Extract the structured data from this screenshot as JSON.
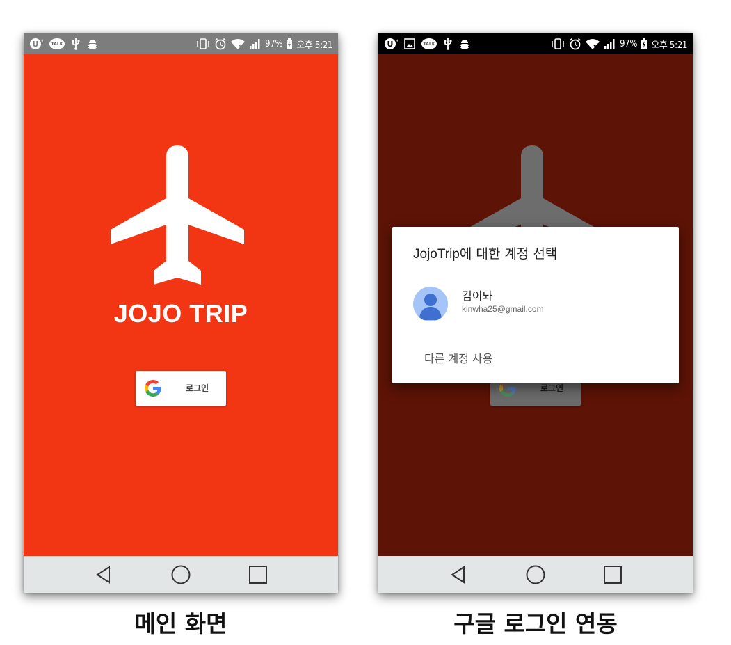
{
  "statusbar": {
    "battery": "97%",
    "time": "오후 5:21",
    "talk_label": "TALK"
  },
  "main_screen": {
    "app_title": "JOJO TRIP",
    "google_button_label": "로그인",
    "caption": "메인 화면"
  },
  "login_screen": {
    "google_button_label": "로그인",
    "dialog": {
      "title_app": "JojoTrip",
      "title_rest": "에 대한 계정 선택",
      "account_name": "김이놔",
      "account_email": "kinwha25@gmail.com",
      "other_account": "다른 계정 사용"
    },
    "caption": "구글 로그인 연동"
  },
  "colors": {
    "main_bg": "#f23513",
    "dimmed_bg": "#5d1306",
    "navbar_bg": "#e3e6e7",
    "avatar_bg": "#a5c4f7",
    "avatar_fg": "#3f6fd1"
  },
  "icons": [
    "u-plus-icon",
    "kakaotalk-icon",
    "usb-icon",
    "android-debug-icon",
    "vibrate-icon",
    "alarm-icon",
    "wifi-icon",
    "signal-icon",
    "battery-icon",
    "gallery-icon",
    "airplane-icon",
    "google-g-icon",
    "back-icon",
    "home-icon",
    "recents-icon",
    "account-avatar-icon"
  ]
}
